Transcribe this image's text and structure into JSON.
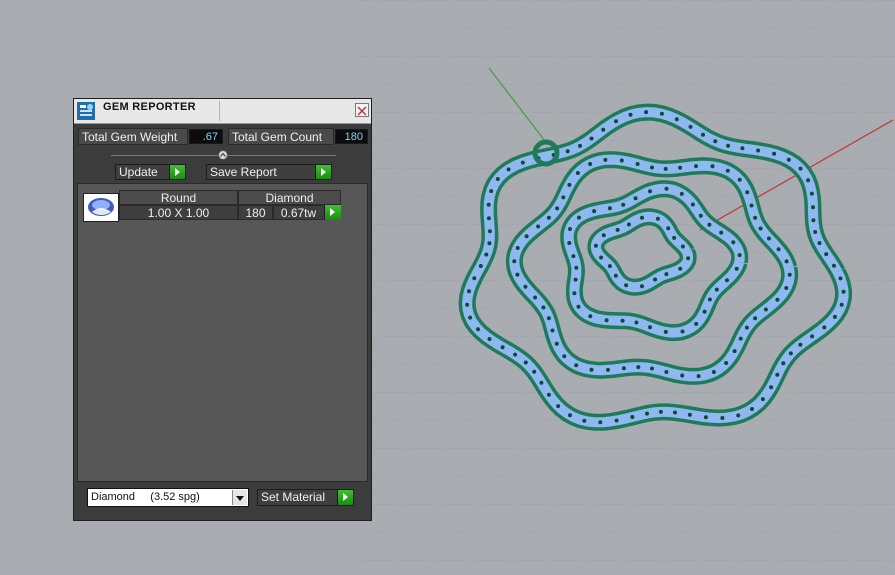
{
  "panel": {
    "title": "GEM REPORTER",
    "icon": "gem-reporter-icon",
    "close_icon": "close-icon",
    "weight_label": "Total Gem Weight",
    "weight_value": ".67",
    "count_label": "Total Gem Count",
    "count_value": "180",
    "update_label": "Update",
    "save_label": "Save Report"
  },
  "gems": {
    "header_shape": "Round",
    "header_material": "Diamond",
    "rows": [
      {
        "size": "1.00 X 1.00",
        "count": "180",
        "weight": "0.67tw",
        "thumb_icon": "diamond-gem-icon"
      }
    ]
  },
  "material": {
    "selected": "Diamond     (3.52 spg)",
    "set_label": "Set Material"
  },
  "colors": {
    "viewport_bg": "#a9adb2",
    "grid": "#8f959b",
    "axis_x": "#c83232",
    "axis_y": "#3fa03f",
    "metal": "#1f7a5a",
    "gem": "#8fb8f0",
    "accent_button": "#2aa61e",
    "value_text": "#7fd6ff"
  }
}
